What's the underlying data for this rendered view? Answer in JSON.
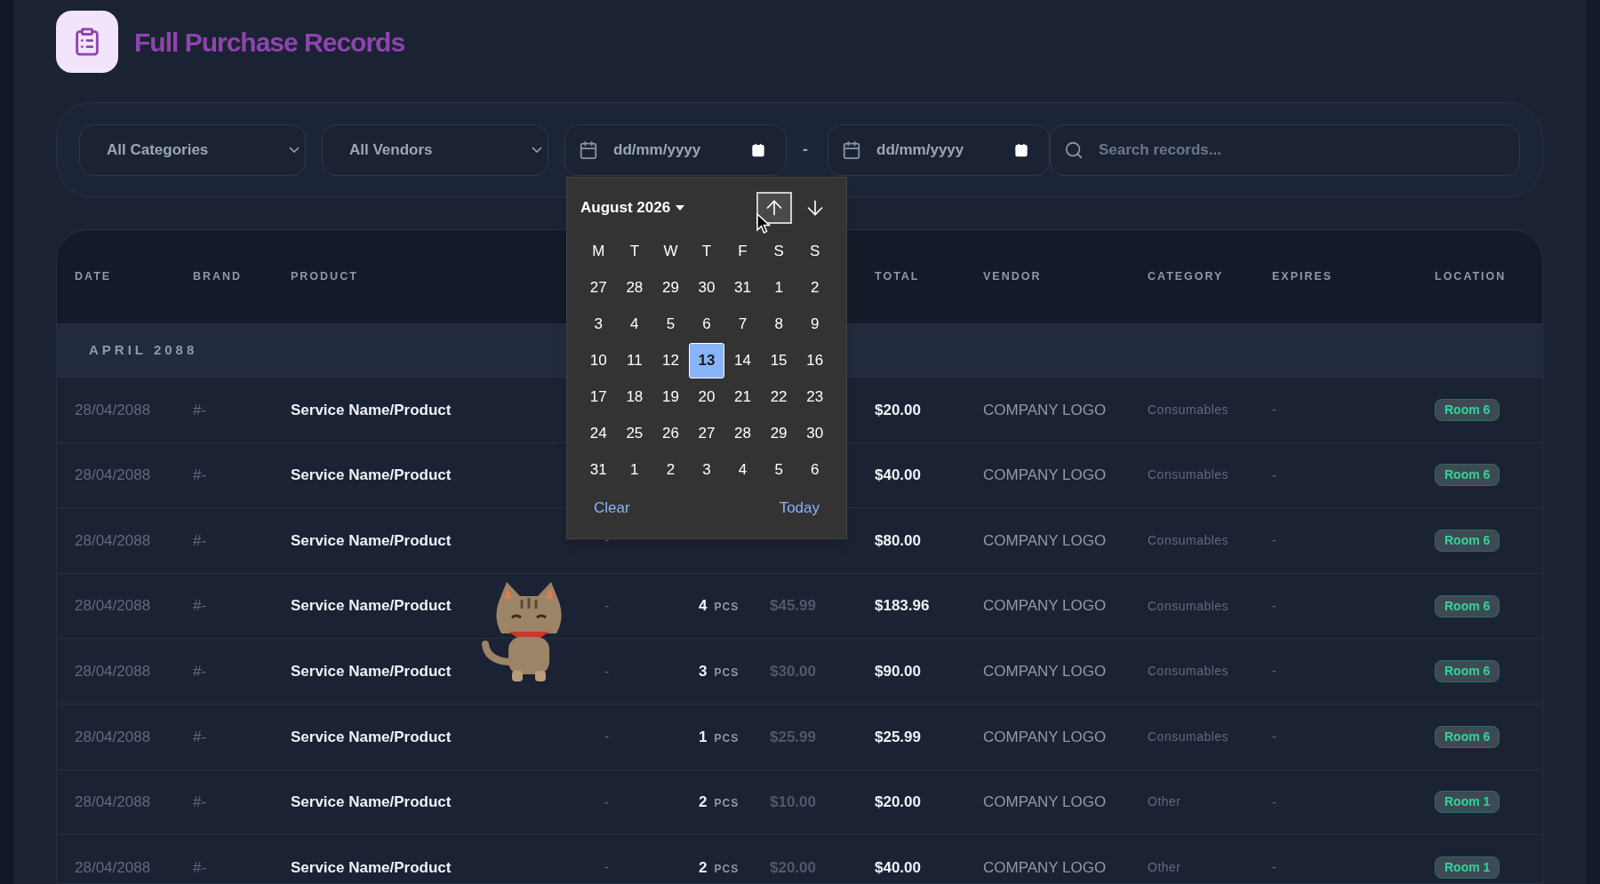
{
  "header": {
    "title": "Full Purchase Records"
  },
  "filters": {
    "category": "All Categories",
    "vendor": "All Vendors",
    "date_from": {
      "placeholder": "dd/mm/yyyy"
    },
    "separator": "-",
    "date_to": {
      "placeholder": "dd/mm/yyyy"
    },
    "search": {
      "placeholder": "Search records..."
    }
  },
  "table": {
    "columns": [
      "DATE",
      "BRAND",
      "PRODUCT",
      "TOTAL",
      "VENDOR",
      "CATEGORY",
      "EXPIRES",
      "LOCATION"
    ],
    "group": "APRIL 2088",
    "rows": [
      {
        "date": "28/04/2088",
        "brand": "#-",
        "product": "Service Name/Product",
        "total": "$20.00",
        "vendor": "COMPANY LOGO",
        "category": "Consumables",
        "expires": "-",
        "location": "Room 6"
      },
      {
        "date": "28/04/2088",
        "brand": "#-",
        "product": "Service Name/Product",
        "total": "$40.00",
        "vendor": "COMPANY LOGO",
        "category": "Consumables",
        "expires": "-",
        "location": "Room 6"
      },
      {
        "date": "28/04/2088",
        "brand": "#-",
        "product": "Service Name/Product",
        "column_4": "-",
        "total": "$80.00",
        "vendor": "COMPANY LOGO",
        "category": "Consumables",
        "expires": "-",
        "location": "Room 6"
      },
      {
        "date": "28/04/2088",
        "brand": "#-",
        "product": "Service Name/Product",
        "column_4": "-",
        "qty": "4",
        "unit": "PCS",
        "price": "$45.99",
        "total": "$183.96",
        "vendor": "COMPANY LOGO",
        "category": "Consumables",
        "expires": "-",
        "location": "Room 6"
      },
      {
        "date": "28/04/2088",
        "brand": "#-",
        "product": "Service Name/Product",
        "column_4": "-",
        "qty": "3",
        "unit": "PCS",
        "price": "$30.00",
        "total": "$90.00",
        "vendor": "COMPANY LOGO",
        "category": "Consumables",
        "expires": "-",
        "location": "Room 6"
      },
      {
        "date": "28/04/2088",
        "brand": "#-",
        "product": "Service Name/Product",
        "column_4": "-",
        "qty": "1",
        "unit": "PCS",
        "price": "$25.99",
        "total": "$25.99",
        "vendor": "COMPANY LOGO",
        "category": "Consumables",
        "expires": "-",
        "location": "Room 6"
      },
      {
        "date": "28/04/2088",
        "brand": "#-",
        "product": "Service Name/Product",
        "column_4": "-",
        "qty": "2",
        "unit": "PCS",
        "price": "$10.00",
        "total": "$20.00",
        "vendor": "COMPANY LOGO",
        "category": "Other",
        "expires": "-",
        "location": "Room 1"
      },
      {
        "date": "28/04/2088",
        "brand": "#-",
        "product": "Service Name/Product",
        "column_4": "-",
        "qty": "2",
        "unit": "PCS",
        "price": "$20.00",
        "total": "$40.00",
        "vendor": "COMPANY LOGO",
        "category": "Other",
        "expires": "-",
        "location": "Room 1"
      }
    ]
  },
  "calendar": {
    "month": "August 2026",
    "weekdays": [
      "M",
      "T",
      "W",
      "T",
      "F",
      "S",
      "S"
    ],
    "weeks": [
      [
        {
          "day": "27",
          "selected": false
        },
        {
          "day": "28",
          "selected": false
        },
        {
          "day": "29",
          "selected": false
        },
        {
          "day": "30",
          "selected": false
        },
        {
          "day": "31",
          "selected": false
        },
        {
          "day": "1",
          "selected": false
        },
        {
          "day": "2",
          "selected": false
        }
      ],
      [
        {
          "day": "3",
          "selected": false
        },
        {
          "day": "4",
          "selected": false
        },
        {
          "day": "5",
          "selected": false
        },
        {
          "day": "6",
          "selected": false
        },
        {
          "day": "7",
          "selected": false
        },
        {
          "day": "8",
          "selected": false
        },
        {
          "day": "9",
          "selected": false
        }
      ],
      [
        {
          "day": "10",
          "selected": false
        },
        {
          "day": "11",
          "selected": false
        },
        {
          "day": "12",
          "selected": false
        },
        {
          "day": "13",
          "selected": true
        },
        {
          "day": "14",
          "selected": false
        },
        {
          "day": "15",
          "selected": false
        },
        {
          "day": "16",
          "selected": false
        }
      ],
      [
        {
          "day": "17",
          "selected": false
        },
        {
          "day": "18",
          "selected": false
        },
        {
          "day": "19",
          "selected": false
        },
        {
          "day": "20",
          "selected": false
        },
        {
          "day": "21",
          "selected": false
        },
        {
          "day": "22",
          "selected": false
        },
        {
          "day": "23",
          "selected": false
        }
      ],
      [
        {
          "day": "24",
          "selected": false
        },
        {
          "day": "25",
          "selected": false
        },
        {
          "day": "26",
          "selected": false
        },
        {
          "day": "27",
          "selected": false
        },
        {
          "day": "28",
          "selected": false
        },
        {
          "day": "29",
          "selected": false
        },
        {
          "day": "30",
          "selected": false
        }
      ],
      [
        {
          "day": "31",
          "selected": false
        },
        {
          "day": "1",
          "selected": false
        },
        {
          "day": "2",
          "selected": false
        },
        {
          "day": "3",
          "selected": false
        },
        {
          "day": "4",
          "selected": false
        },
        {
          "day": "5",
          "selected": false
        },
        {
          "day": "6",
          "selected": false
        }
      ]
    ],
    "actions": [
      "Clear",
      "Today"
    ]
  }
}
